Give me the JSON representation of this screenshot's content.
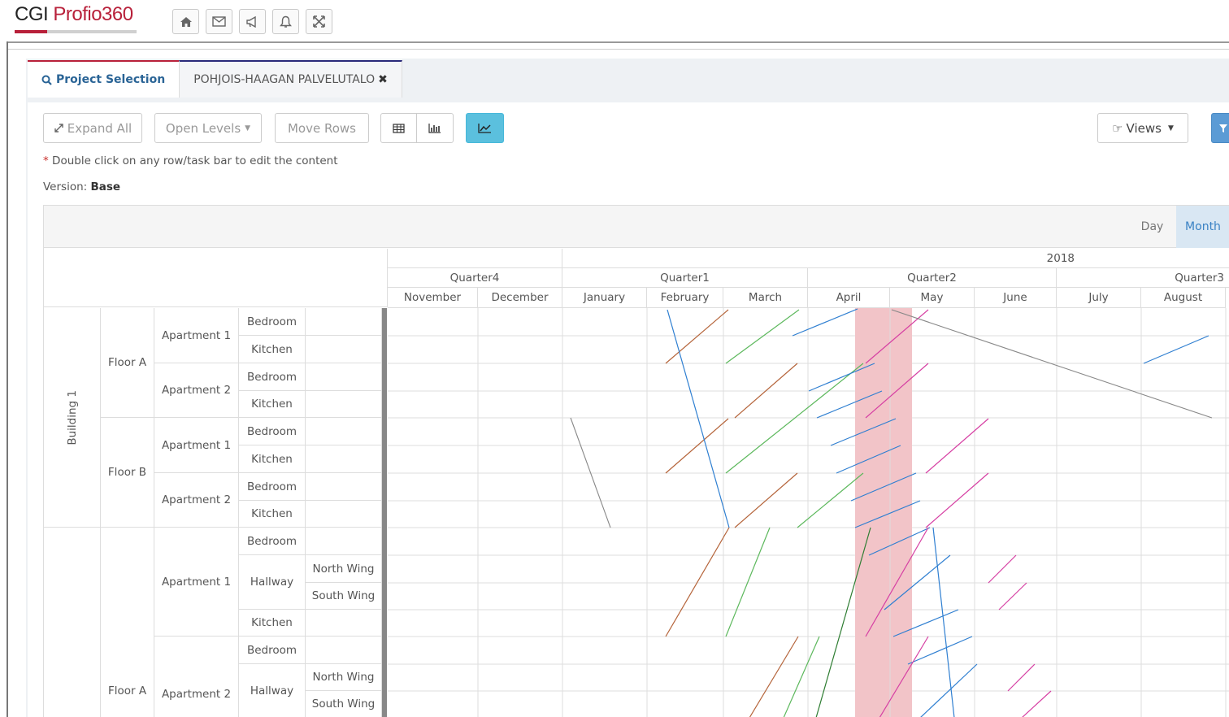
{
  "app": {
    "logo_main": "CGI",
    "logo_product": "Profio360"
  },
  "top_icons": [
    "home-icon",
    "envelope-icon",
    "bullhorn-icon",
    "bell-icon",
    "fullscreen-icon"
  ],
  "tabs": [
    {
      "label": "Project Selection",
      "active": true
    },
    {
      "label": "POHJOIS-HAAGAN PALVELUTALO",
      "active": false
    }
  ],
  "toolbar": {
    "expand_all": "Expand All",
    "open_levels": "Open Levels",
    "move_rows": "Move Rows",
    "views": "Views"
  },
  "note": "Double click on any row/task bar to edit the content",
  "version_label": "Version:",
  "version_value": "Base",
  "scale": {
    "day": "Day",
    "month": "Month",
    "active": "Month"
  },
  "timeline": {
    "year": "2018",
    "quarters": [
      "Quarter4",
      "Quarter1",
      "Quarter2",
      "Quarter3"
    ],
    "months": [
      "November",
      "December",
      "January",
      "February",
      "March",
      "April",
      "May",
      "June",
      "July",
      "August"
    ]
  },
  "tree": {
    "building": "Building 1",
    "floors": [
      "Floor A",
      "Floor B",
      "Floor A"
    ],
    "apartments": [
      "Apartment 1",
      "Apartment 2",
      "Apartment 1",
      "Apartment 2",
      "Apartment 1",
      "Apartment 2"
    ],
    "rooms": [
      "Bedroom",
      "Kitchen",
      "Bedroom",
      "Kitchen",
      "Bedroom",
      "Kitchen",
      "Bedroom",
      "Kitchen",
      "Bedroom",
      "Hallway",
      "Kitchen",
      "Bedroom",
      "Hallway"
    ],
    "wings": [
      "North Wing",
      "South Wing",
      "North Wing",
      "South Wing"
    ]
  },
  "colors": {
    "accent": "#b8203a",
    "link": "#2a6496",
    "highlight": "#f2c4c8",
    "blue_btn": "#5bc0de"
  }
}
